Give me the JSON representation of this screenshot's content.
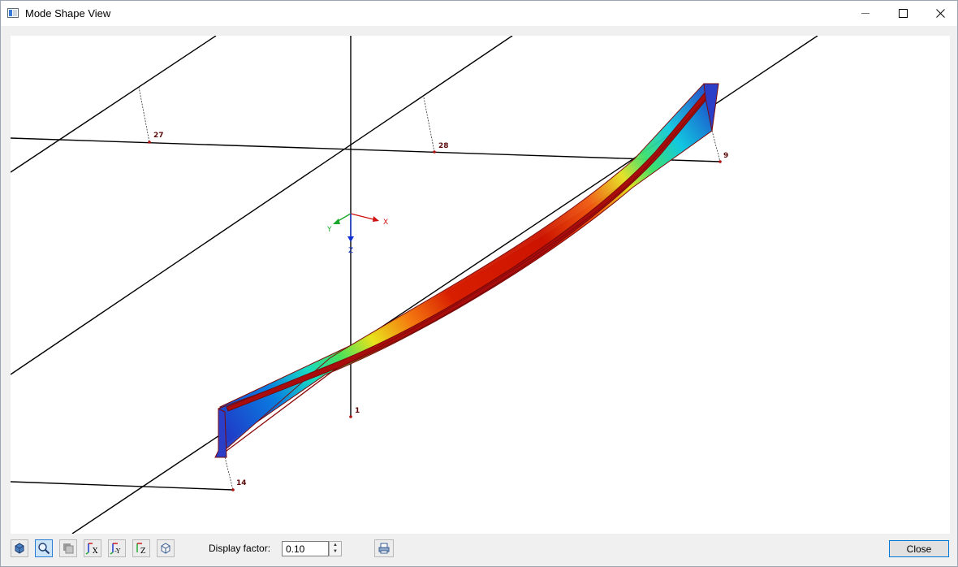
{
  "window": {
    "title": "Mode Shape View",
    "minimize_glyph": "—",
    "maximize_glyph": "☐",
    "close_glyph": "✕"
  },
  "viewport": {
    "axes": {
      "x": "X",
      "y": "Y",
      "z": "Z"
    },
    "nodes": [
      "27",
      "28",
      "9",
      "1",
      "14"
    ],
    "colors": {
      "low": "#1f3dc8",
      "mid": "#2fe06a",
      "high": "#d81e00",
      "node": "#b01010"
    }
  },
  "toolbar": {
    "icons": [
      "rotate-view-icon",
      "zoom-icon",
      "render-mode-icon",
      "view-x-icon",
      "view-neg-y-icon",
      "view-z-icon",
      "view-iso-icon"
    ],
    "view_x_label": "X",
    "view_neg_y_label": "-Y",
    "view_z_label": "Z"
  },
  "display_factor": {
    "label": "Display factor:",
    "value": "0.10"
  },
  "close_label": "Close"
}
